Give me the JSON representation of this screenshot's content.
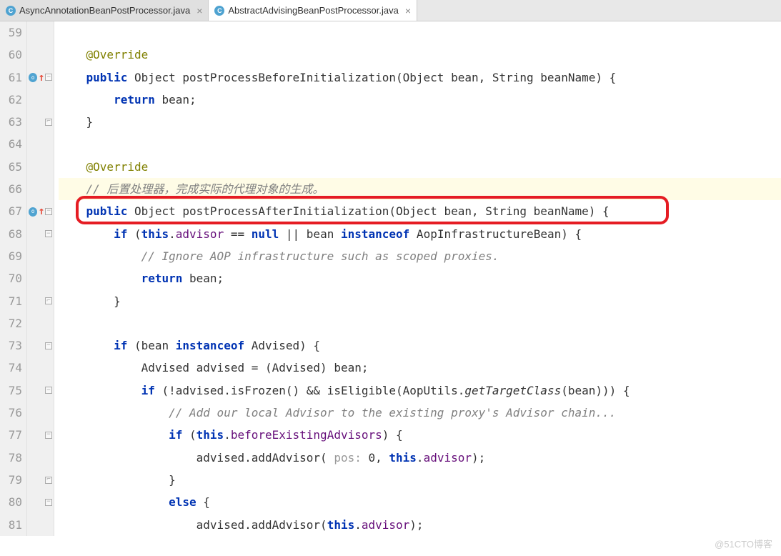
{
  "tabs": [
    {
      "label": "AsyncAnnotationBeanPostProcessor.java",
      "active": false
    },
    {
      "label": "AbstractAdvisingBeanPostProcessor.java",
      "active": true
    }
  ],
  "lines": [
    {
      "num": "59",
      "markers": []
    },
    {
      "num": "60",
      "markers": []
    },
    {
      "num": "61",
      "markers": [
        "override",
        "arrow",
        "fold-open"
      ]
    },
    {
      "num": "62",
      "markers": []
    },
    {
      "num": "63",
      "markers": [
        "fold-close"
      ]
    },
    {
      "num": "64",
      "markers": []
    },
    {
      "num": "65",
      "markers": []
    },
    {
      "num": "66",
      "markers": [],
      "hi": true
    },
    {
      "num": "67",
      "markers": [
        "override",
        "arrow",
        "fold-open"
      ]
    },
    {
      "num": "68",
      "markers": [
        "fold-open"
      ]
    },
    {
      "num": "69",
      "markers": []
    },
    {
      "num": "70",
      "markers": []
    },
    {
      "num": "71",
      "markers": [
        "fold-close"
      ]
    },
    {
      "num": "72",
      "markers": []
    },
    {
      "num": "73",
      "markers": [
        "fold-open"
      ]
    },
    {
      "num": "74",
      "markers": []
    },
    {
      "num": "75",
      "markers": [
        "fold-open"
      ]
    },
    {
      "num": "76",
      "markers": []
    },
    {
      "num": "77",
      "markers": [
        "fold-open"
      ]
    },
    {
      "num": "78",
      "markers": []
    },
    {
      "num": "79",
      "markers": [
        "fold-close"
      ]
    },
    {
      "num": "80",
      "markers": [
        "fold-open"
      ]
    },
    {
      "num": "81",
      "markers": []
    }
  ],
  "code": {
    "l59": "",
    "l60_anno": "@Override",
    "l61_kw1": "public",
    "l61_t1": " Object postProcessBeforeInitialization(Object bean, String beanName) {",
    "l62_kw": "return",
    "l62_t": " bean;",
    "l63": "}",
    "l64": "",
    "l65_anno": "@Override",
    "l66_c": "// 后置处理器，完成实际的代理对象的生成。",
    "l67_kw": "public",
    "l67_t": " Object postProcessAfterInitialization(Object bean, String beanName) {",
    "l68_kw1": "if",
    "l68_t1": " (",
    "l68_kw2": "this",
    "l68_t2": ".",
    "l68_f1": "advisor",
    "l68_t3": " == ",
    "l68_kw3": "null",
    "l68_t4": " || bean ",
    "l68_kw4": "instanceof",
    "l68_t5": " AopInfrastructureBean) {",
    "l69_c": "// Ignore AOP infrastructure such as scoped proxies.",
    "l70_kw": "return",
    "l70_t": " bean;",
    "l71": "}",
    "l72": "",
    "l73_kw1": "if",
    "l73_t1": " (bean ",
    "l73_kw2": "instanceof",
    "l73_t2": " Advised) {",
    "l74": "Advised advised = (Advised) bean;",
    "l75_kw": "if",
    "l75_t1": " (!advised.isFrozen() && isEligible(AopUtils.",
    "l75_m": "getTargetClass",
    "l75_t2": "(bean))) {",
    "l76_c": "// Add our local Advisor to the existing proxy's Advisor chain...",
    "l77_kw1": "if",
    "l77_t1": " (",
    "l77_kw2": "this",
    "l77_t2": ".",
    "l77_f": "beforeExistingAdvisors",
    "l77_t3": ") {",
    "l78_t1": "advised.addAdvisor( ",
    "l78_h": "pos: ",
    "l78_t2": "0, ",
    "l78_kw": "this",
    "l78_t3": ".",
    "l78_f": "advisor",
    "l78_t4": ");",
    "l79": "}",
    "l80_kw": "else",
    "l80_t": " {",
    "l81_t1": "advised.addAdvisor(",
    "l81_kw": "this",
    "l81_t2": ".",
    "l81_f": "advisor",
    "l81_t3": ");"
  },
  "watermark": "@51CTO博客"
}
